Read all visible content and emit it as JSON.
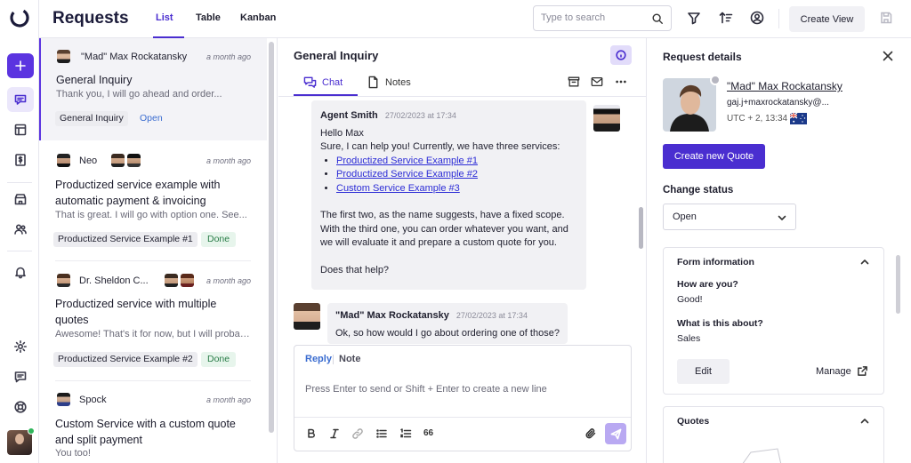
{
  "header": {
    "title": "Requests",
    "tabs": [
      "List",
      "Table",
      "Kanban"
    ],
    "search_placeholder": "Type to search",
    "create_view_label": "Create View"
  },
  "requests": [
    {
      "name": "\"Mad\" Max Rockatansky",
      "ago": "a month ago",
      "subject": "General Inquiry",
      "preview": "Thank you, I will go ahead and order...",
      "tag": "General Inquiry",
      "status": "Open"
    },
    {
      "name": "Neo",
      "ago": "a month ago",
      "subject": "Productized service example with automatic payment & invoicing",
      "preview": "That is great. I will go with option one. See...",
      "tag": "Productized Service Example #1",
      "status": "Done"
    },
    {
      "name": "Dr. Sheldon C...",
      "ago": "a month ago",
      "subject": "Productized service with multiple quotes",
      "preview": "Awesome! That's it for now, but I will probabl...",
      "tag": "Productized Service Example #2",
      "status": "Done"
    },
    {
      "name": "Spock",
      "ago": "a month ago",
      "subject": "Custom Service with a custom quote and split payment",
      "preview": "You too!",
      "tag": "",
      "status": ""
    }
  ],
  "chat": {
    "title": "General Inquiry",
    "tabs": [
      "Chat",
      "Notes"
    ],
    "messages": [
      {
        "author": "Agent Smith",
        "time": "27/02/2023 at 17:34",
        "line1": "Hello Max",
        "line2": "Sure, I can help you! Currently, we have three services:",
        "links": [
          "Productized Service Example #1",
          "Productized Service Example #2",
          "Custom Service Example #3"
        ],
        "para": "The first two, as the name suggests, have a fixed scope. With the third one, you can order whatever you want, and we will evaluate it and prepare a custom quote for you.",
        "closing": "Does that help?"
      },
      {
        "author": "\"Mad\" Max Rockatansky",
        "time": "27/02/2023 at 17:34",
        "text": "Ok, so how would I go about ordering one of those?"
      }
    ],
    "composer": {
      "reply_label": "Reply",
      "note_label": "Note",
      "placeholder": "Press Enter to send or Shift + Enter to create a new line",
      "quote_glyph": "66"
    }
  },
  "details": {
    "title": "Request details",
    "contact_name": "\"Mad\" Max Rockatansky",
    "contact_email": "gaj.j+maxrockatansky@...",
    "timezone": "UTC + 2, 13:34",
    "create_quote_label": "Create new Quote",
    "change_status_label": "Change status",
    "status_value": "Open",
    "form": {
      "title": "Form information",
      "q1": "How are you?",
      "a1": "Good!",
      "q2": "What is this about?",
      "a2": "Sales",
      "edit_label": "Edit",
      "manage_label": "Manage"
    },
    "quotes_title": "Quotes"
  },
  "colors": {
    "accent": "#5b34e0",
    "primary_button": "#4a2ed0",
    "open_status": "#3a6cd0",
    "done_status_bg": "#e7f5ec",
    "done_status_text": "#2a7d48"
  },
  "icons": [
    "logo-icon",
    "plus-icon",
    "chat-bubble-icon",
    "layout-icon",
    "dollar-document-icon",
    "store-icon",
    "users-icon",
    "bell-icon",
    "gear-icon",
    "message-icon",
    "lifebuoy-icon",
    "search-icon",
    "filter-icon",
    "sort-icon",
    "user-circle-icon",
    "save-icon",
    "info-icon",
    "archive-icon",
    "mail-icon",
    "more-icon",
    "close-icon",
    "chevron-down-icon",
    "chevron-up-icon",
    "external-link-icon",
    "bold-icon",
    "italic-icon",
    "link-icon",
    "bullet-list-icon",
    "numbered-list-icon",
    "attach-icon",
    "send-icon"
  ]
}
